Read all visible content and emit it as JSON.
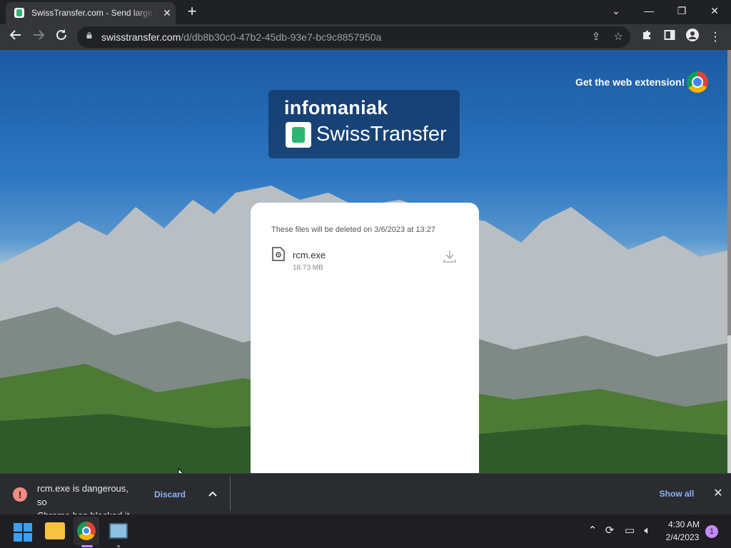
{
  "browser": {
    "tab_title": "SwissTransfer.com - Send large files",
    "url_domain": "swisstransfer.com",
    "url_path": "/d/db8b30c0-47b2-45db-93e7-bc9c8857950a",
    "icons": [
      "back-arrow-icon",
      "forward-arrow-icon",
      "reload-icon",
      "lock-icon",
      "share-icon",
      "star-icon",
      "extensions-icon",
      "side-panel-icon",
      "profile-icon",
      "menu-icon"
    ]
  },
  "page": {
    "brand_top": "infomaniak",
    "brand_name": "SwissTransfer",
    "extension_text": "Get the web extension!",
    "deletion_note": "These files will be deleted on 3/6/2023 at 13:27",
    "file": {
      "name": "rcm.exe",
      "size": "18.73 MB"
    }
  },
  "download_bar": {
    "message_line1": "rcm.exe is dangerous, so",
    "message_line2": "Chrome has blocked it.",
    "discard_label": "Discard",
    "show_all_label": "Show all",
    "warning_color": "#f28b82",
    "link_color": "#8ab4f8"
  },
  "taskbar": {
    "time": "4:30 AM",
    "date": "2/4/2023",
    "notification_count": "1"
  }
}
